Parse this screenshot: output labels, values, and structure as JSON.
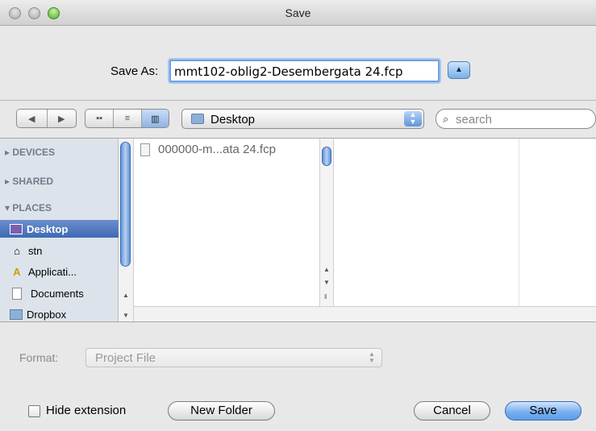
{
  "window": {
    "title": "Save"
  },
  "saveas": {
    "label": "Save As:",
    "filename": "mmt102-oblig2-Desembergata 24.fcp"
  },
  "toolbar": {
    "location": "Desktop",
    "search_placeholder": "search",
    "view_mode": "columns"
  },
  "sidebar": {
    "sections": [
      {
        "heading": "DEVICES",
        "expanded": false
      },
      {
        "heading": "SHARED",
        "expanded": false
      },
      {
        "heading": "PLACES",
        "expanded": true
      }
    ],
    "items": [
      {
        "label": "Desktop",
        "icon": "desktop-icon",
        "selected": true
      },
      {
        "label": "stn",
        "icon": "home-icon",
        "selected": false
      },
      {
        "label": "Applicati...",
        "icon": "applications-icon",
        "selected": false
      },
      {
        "label": "Documents",
        "icon": "document-icon",
        "selected": false
      },
      {
        "label": "Dropbox",
        "icon": "folder-icon",
        "selected": false
      }
    ]
  },
  "browser": {
    "files": [
      {
        "name": "000000-m...ata 24.fcp",
        "icon": "file-icon"
      }
    ]
  },
  "format": {
    "label": "Format:",
    "value": "Project File"
  },
  "buttons": {
    "hide_extension": "Hide extension",
    "hide_extension_checked": false,
    "new_folder": "New Folder",
    "cancel": "Cancel",
    "save": "Save"
  },
  "colors": {
    "accent": "#5c9ee8",
    "sidebar_bg": "#dde3ea",
    "selection": "#3e69b4"
  }
}
